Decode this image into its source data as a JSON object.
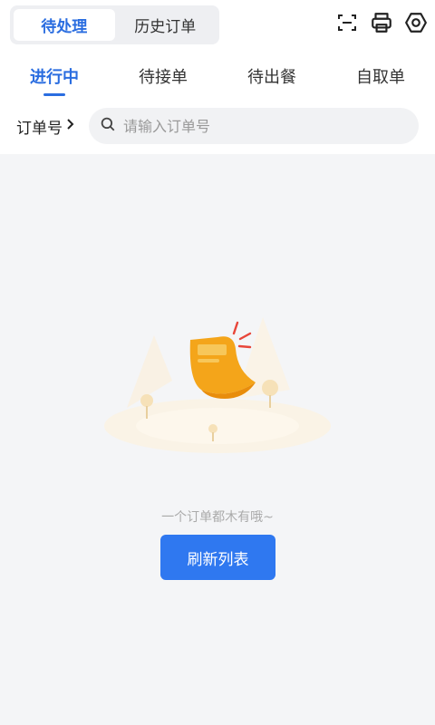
{
  "segment": {
    "pending_label": "待处理",
    "history_label": "历史订单"
  },
  "tabs": [
    {
      "label": "进行中"
    },
    {
      "label": "待接单"
    },
    {
      "label": "待出餐"
    },
    {
      "label": "自取单"
    }
  ],
  "search": {
    "order_type_label": "订单号",
    "placeholder": "请输入订单号"
  },
  "empty": {
    "message": "一个订单都木有哦~",
    "refresh_label": "刷新列表"
  },
  "icons": {
    "scan": "scan-icon",
    "print": "printer-icon",
    "settings": "settings-icon",
    "search": "search-icon"
  },
  "colors": {
    "accent": "#2a6de0",
    "button": "#2f78f0"
  }
}
